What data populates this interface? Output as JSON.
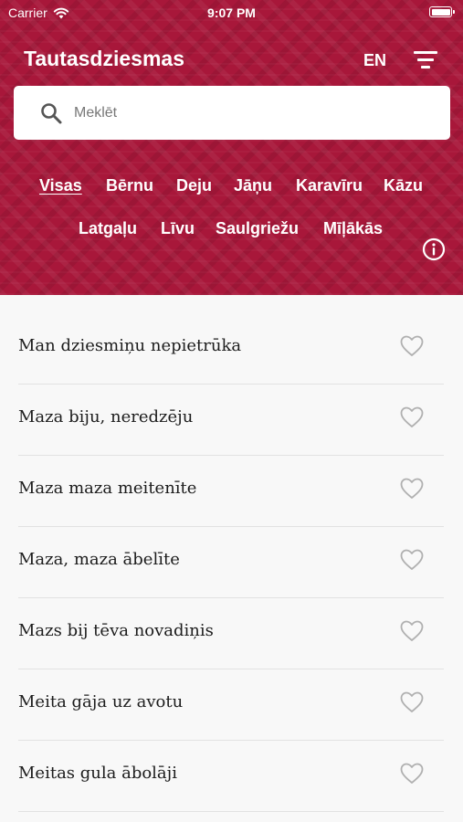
{
  "status_bar": {
    "carrier": "Carrier",
    "time": "9:07 PM"
  },
  "header": {
    "title": "Tautasdziesmas",
    "language": "EN",
    "accent_color": "#a8173a"
  },
  "search": {
    "placeholder": "Meklēt",
    "value": ""
  },
  "categories": [
    {
      "label": "Visas",
      "active": true
    },
    {
      "label": "Bērnu"
    },
    {
      "label": "Deju"
    },
    {
      "label": "Jāņu"
    },
    {
      "label": "Karavīru"
    },
    {
      "label": "Kāzu"
    },
    {
      "label": "Latgaļu"
    },
    {
      "label": "Līvu"
    },
    {
      "label": "Saulgriežu"
    },
    {
      "label": "Mīļākās"
    }
  ],
  "songs": [
    {
      "title": "Man dziesmiņu nepietrūka",
      "favorite": false
    },
    {
      "title": "Maza biju, neredzēju",
      "favorite": false
    },
    {
      "title": "Maza maza meitenīte",
      "favorite": false
    },
    {
      "title": "Maza, maza ābelīte",
      "favorite": false
    },
    {
      "title": "Mazs bij tēva novadiņis",
      "favorite": false
    },
    {
      "title": "Meita gāja uz avotu",
      "favorite": false
    },
    {
      "title": "Meitas gula ābolāji",
      "favorite": false
    }
  ]
}
